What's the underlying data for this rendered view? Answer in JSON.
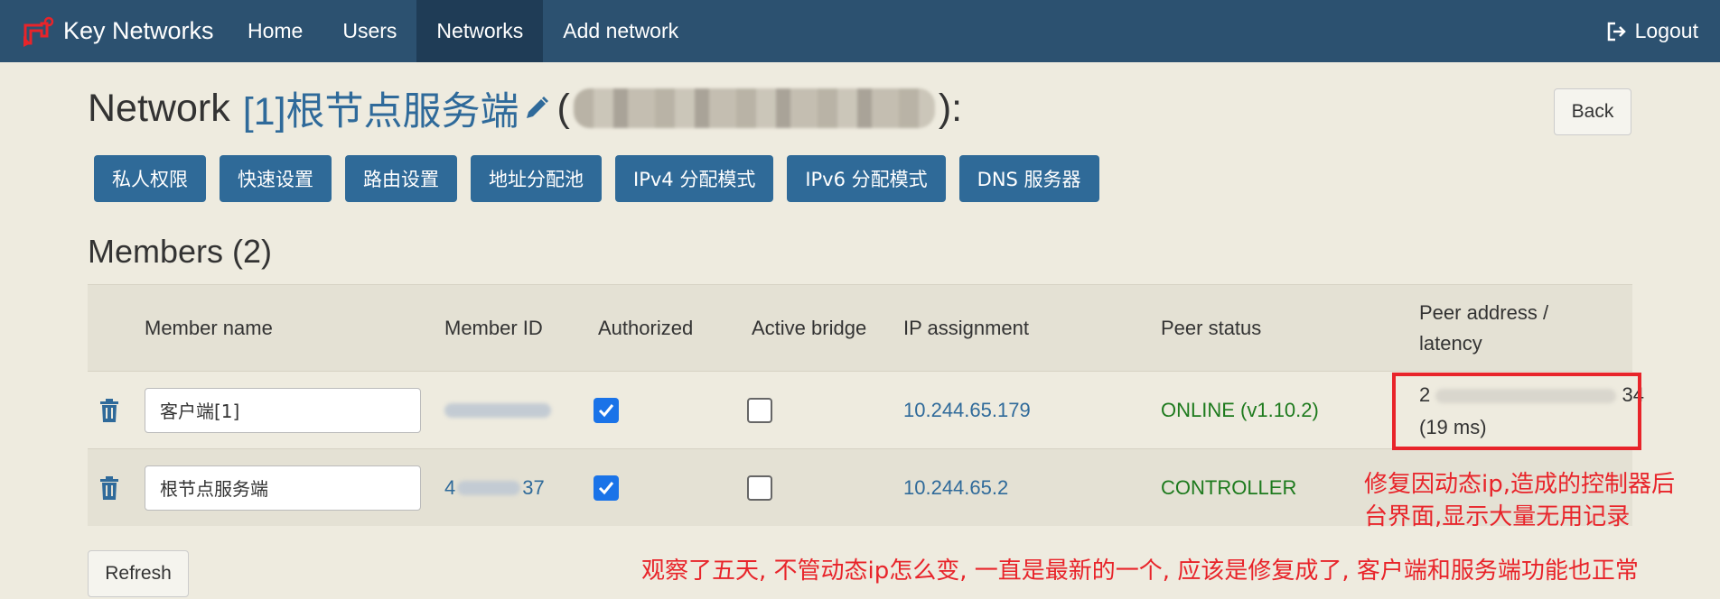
{
  "navbar": {
    "brand": "Key Networks",
    "items": [
      "Home",
      "Users",
      "Networks",
      "Add network"
    ],
    "active": "Networks",
    "logout": "Logout"
  },
  "header": {
    "prefix": "Network",
    "network_name": "[1]根节点服务端",
    "open_paren": "(",
    "close_paren": "):",
    "back": "Back"
  },
  "toolbar": [
    "私人权限",
    "快速设置",
    "路由设置",
    "地址分配池",
    "IPv4 分配模式",
    "IPv6 分配模式",
    "DNS 服务器"
  ],
  "members": {
    "title": "Members (2)",
    "columns": {
      "name": "Member name",
      "id": "Member ID",
      "authorized": "Authorized",
      "bridge": "Active bridge",
      "ip": "IP assignment",
      "status": "Peer status",
      "peer_line1": "Peer address /",
      "peer_line2": "latency"
    },
    "rows": [
      {
        "name": "客户端[1]",
        "id_suffix": "",
        "authorized": true,
        "bridge": false,
        "ip": "10.244.65.179",
        "status": "ONLINE (v1.10.2)",
        "peer_start": "2",
        "peer_end": "34",
        "latency": "(19 ms)"
      },
      {
        "name": "根节点服务端",
        "id_prefix": "4",
        "id_suffix": "37",
        "authorized": true,
        "bridge": false,
        "ip": "10.244.65.2",
        "status": "CONTROLLER"
      }
    ]
  },
  "refresh": "Refresh",
  "annotations": {
    "line1": "修复因动态ip,造成的控制器后",
    "line2": "台界面,显示大量无用记录",
    "line3": "观察了五天, 不管动态ip怎么变, 一直是最新的一个, 应该是修复成了, 客户端和服务端功能也正常"
  },
  "colors": {
    "navbar": "#2c5170",
    "accent": "#2f6a98",
    "online": "#1d7a1d",
    "annotation": "#e8242a"
  }
}
